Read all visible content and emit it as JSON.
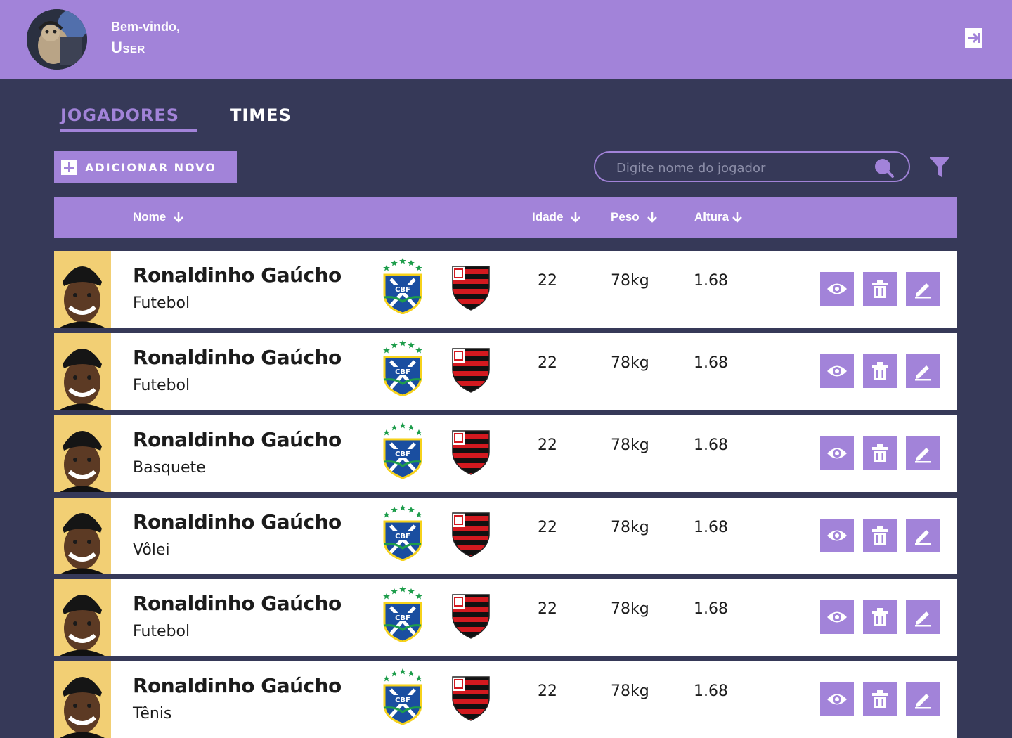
{
  "header": {
    "welcome": "Bem-vindo,",
    "username": "User",
    "logout_icon": "logout-icon"
  },
  "tabs": [
    {
      "label": "JOGADORES",
      "active": true
    },
    {
      "label": "TIMES",
      "active": false
    }
  ],
  "toolbar": {
    "add_label": "ADICIONAR NOVO",
    "search_placeholder": "Digite nome do jogador",
    "search_value": ""
  },
  "table": {
    "columns": [
      "Nome",
      "Idade",
      "Peso",
      "Altura"
    ],
    "rows": [
      {
        "name": "Ronaldinho Gaúcho",
        "sport": "Futebol",
        "age": "22",
        "weight": "78kg",
        "height": "1.68"
      },
      {
        "name": "Ronaldinho Gaúcho",
        "sport": "Futebol",
        "age": "22",
        "weight": "78kg",
        "height": "1.68"
      },
      {
        "name": "Ronaldinho Gaúcho",
        "sport": "Basquete",
        "age": "22",
        "weight": "78kg",
        "height": "1.68"
      },
      {
        "name": "Ronaldinho Gaúcho",
        "sport": "Vôlei",
        "age": "22",
        "weight": "78kg",
        "height": "1.68"
      },
      {
        "name": "Ronaldinho Gaúcho",
        "sport": "Futebol",
        "age": "22",
        "weight": "78kg",
        "height": "1.68"
      },
      {
        "name": "Ronaldinho Gaúcho",
        "sport": "Tênis",
        "age": "22",
        "weight": "78kg",
        "height": "1.68"
      }
    ],
    "badge_text": "CBF"
  },
  "colors": {
    "accent": "#a283d9",
    "background": "#363958",
    "row": "#ffffff"
  }
}
